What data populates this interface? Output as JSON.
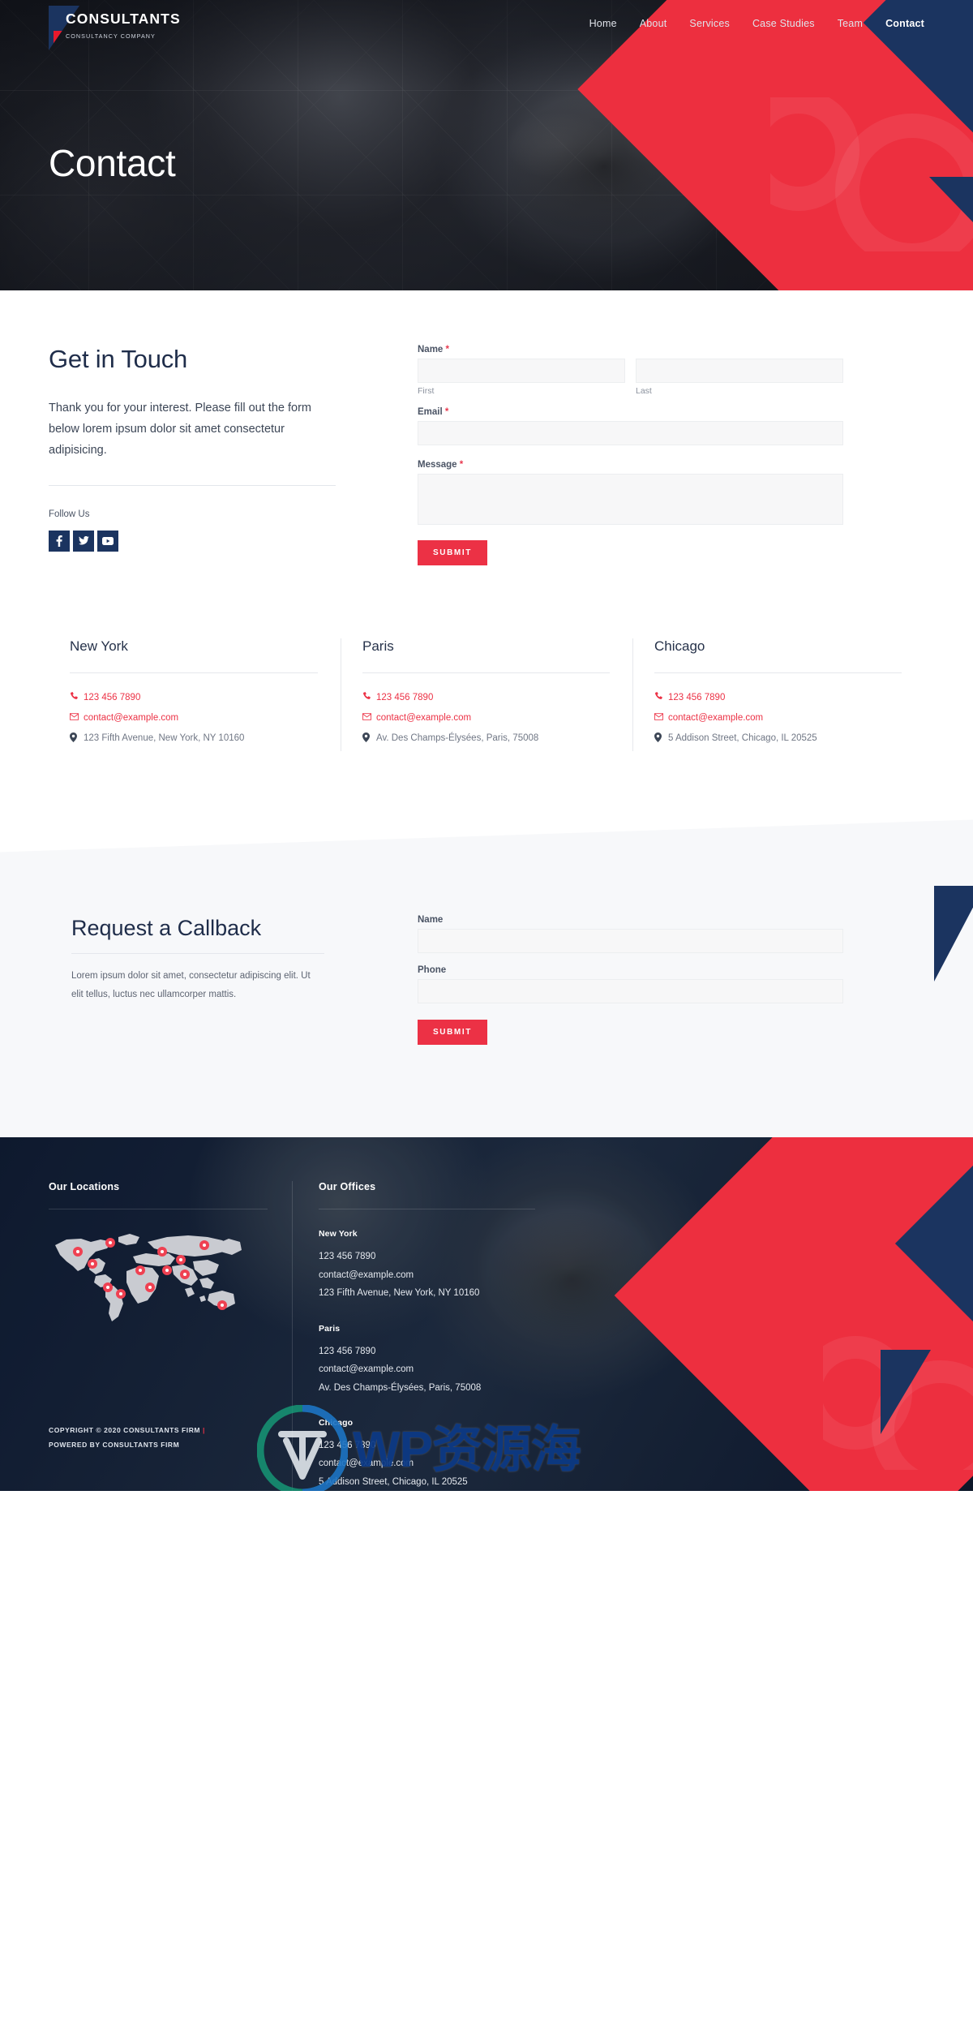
{
  "brand": {
    "name": "CONSULTANTS",
    "tagline": "CONSULTANCY COMPANY",
    "accent_red": "#ec3145",
    "accent_navy": "#1b3460"
  },
  "nav": {
    "items": [
      {
        "label": "Home",
        "active": false
      },
      {
        "label": "About",
        "active": false
      },
      {
        "label": "Services",
        "active": false
      },
      {
        "label": "Case Studies",
        "active": false
      },
      {
        "label": "Team",
        "active": false
      },
      {
        "label": "Contact",
        "active": true
      }
    ]
  },
  "hero": {
    "title": "Contact"
  },
  "get_in_touch": {
    "heading": "Get in Touch",
    "paragraph": "Thank you for your interest. Please fill out the form below lorem ipsum dolor sit amet consectetur adipisicing.",
    "follow_label": "Follow Us",
    "socials": [
      {
        "name": "facebook-icon",
        "label": "f"
      },
      {
        "name": "twitter-icon",
        "label": "t"
      },
      {
        "name": "youtube-icon",
        "label": "y"
      }
    ]
  },
  "contact_form": {
    "name_label": "Name",
    "name_required": "*",
    "first_sublabel": "First",
    "last_sublabel": "Last",
    "first_value": "",
    "last_value": "",
    "email_label": "Email",
    "email_required": "*",
    "email_value": "",
    "message_label": "Message",
    "message_required": "*",
    "message_value": "",
    "submit_label": "SUBMIT"
  },
  "offices": [
    {
      "city": "New York",
      "phone": "123 456 7890",
      "email": "contact@example.com",
      "address": "123 Fifth Avenue, New York, NY 10160"
    },
    {
      "city": "Paris",
      "phone": "123 456 7890",
      "email": "contact@example.com",
      "address": "Av. Des Champs-Élysées, Paris, 75008"
    },
    {
      "city": "Chicago",
      "phone": "123 456 7890",
      "email": "contact@example.com",
      "address": "5 Addison Street, Chicago, IL 20525"
    }
  ],
  "callback": {
    "heading": "Request a Callback",
    "paragraph": "Lorem ipsum dolor sit amet, consectetur adipiscing elit. Ut elit tellus, luctus nec ullamcorper mattis.",
    "name_label": "Name",
    "name_value": "",
    "phone_label": "Phone",
    "phone_value": "",
    "submit_label": "SUBMIT"
  },
  "footer": {
    "locations_heading": "Our Locations",
    "offices_heading": "Our Offices",
    "offices": [
      {
        "city": "New York",
        "phone": "123 456 7890",
        "email": "contact@example.com",
        "address": "123 Fifth Avenue, New York, NY 10160"
      },
      {
        "city": "Paris",
        "phone": "123 456 7890",
        "email": "contact@example.com",
        "address": "Av. Des Champs-Élysées, Paris, 75008"
      },
      {
        "city": "Chicago",
        "phone": "123 456 7890",
        "email": "contact@example.com",
        "address": "5 Addison Street, Chicago, IL 20525"
      }
    ],
    "copyright_line1": "COPYRIGHT © 2020 CONSULTANTS FIRM",
    "copyright_sep": "|",
    "copyright_line2": "POWERED BY CONSULTANTS FIRM"
  },
  "watermark": {
    "text": "WP资源海"
  }
}
